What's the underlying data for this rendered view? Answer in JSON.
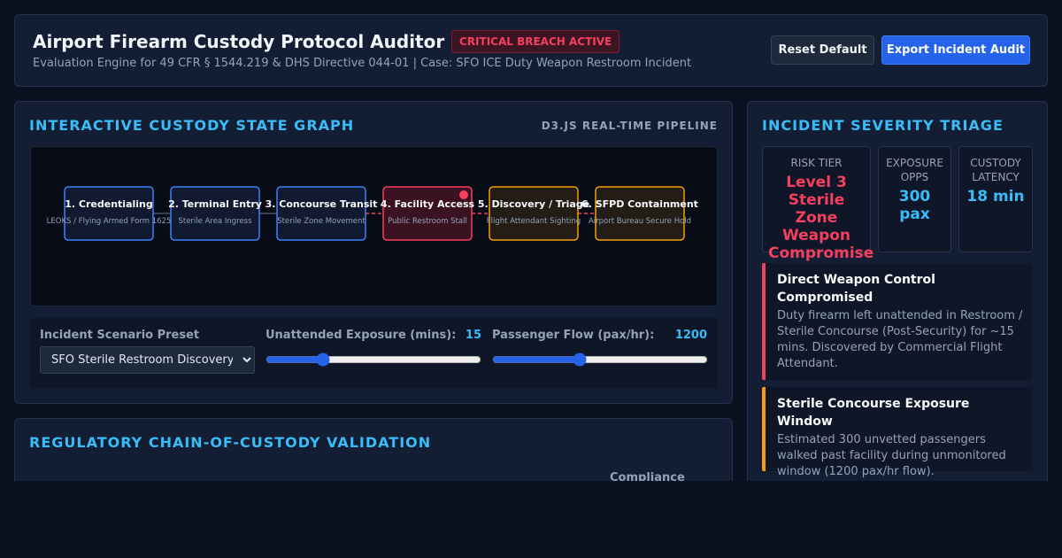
{
  "header": {
    "title": "Airport Firearm Custody Protocol Auditor",
    "badge": "CRITICAL BREACH ACTIVE",
    "subtitle": "Evaluation Engine for 49 CFR § 1544.219 & DHS Directive 044-01 | Case: SFO ICE Duty Weapon Restroom Incident",
    "reset_label": "Reset Default",
    "export_label": "Export Incident Audit"
  },
  "graph_panel": {
    "heading": "INTERACTIVE CUSTODY STATE GRAPH",
    "pipeline_tag": "D3.JS REAL-TIME PIPELINE",
    "nodes": [
      {
        "title": "1. Credentialing",
        "subtitle": "LEOKS / Flying Armed Form 1625",
        "state": "normal"
      },
      {
        "title": "2. Terminal Entry",
        "subtitle": "Sterile Area Ingress",
        "state": "normal"
      },
      {
        "title": "3. Concourse Transit",
        "subtitle": "Sterile Zone Movement",
        "state": "normal"
      },
      {
        "title": "4. Facility Access",
        "subtitle": "Public Restroom Stall",
        "state": "breach"
      },
      {
        "title": "5. Discovery / Triage",
        "subtitle": "Flight Attendant Sighting",
        "state": "warning"
      },
      {
        "title": "6. SFPD Containment",
        "subtitle": "Airport Bureau Secure Hold",
        "state": "warning"
      }
    ],
    "colors": {
      "normal": "#3b82f6",
      "breach": "#f43f5e",
      "warning": "#f59e0b"
    }
  },
  "controls": {
    "preset_label": "Incident Scenario Preset",
    "preset_value": "SFO Sterile Restroom Discovery (N",
    "exposure_label": "Unattended Exposure (mins):",
    "exposure_value": 15,
    "exposure_max": 60,
    "flow_label": "Passenger Flow (pax/hr):",
    "flow_value": 1200,
    "flow_max": 3000
  },
  "triage": {
    "heading": "INCIDENT SEVERITY TRIAGE",
    "metrics": [
      {
        "label": "RISK TIER",
        "value": "Level 3 Sterile Zone Weapon Compromise",
        "color": "#f43f5e"
      },
      {
        "label": "EXPOSURE OPPS",
        "value": "300 pax",
        "color": "#38bdf8"
      },
      {
        "label": "CUSTODY LATENCY",
        "value": "18 min",
        "color": "#38bdf8"
      }
    ],
    "alerts": [
      {
        "title": "Direct Weapon Control Compromised",
        "text": "Duty firearm left unattended in Restroom / Sterile Concourse (Post-Security) for ~15 mins. Discovered by Commercial Flight Attendant."
      },
      {
        "title": "Sterile Concourse Exposure Window",
        "text": "Estimated 300 unvetted passengers walked past facility during unmonitored window (1200 pax/hr flow)."
      }
    ]
  },
  "validation": {
    "heading": "REGULATORY CHAIN-OF-CUSTODY VALIDATION",
    "compliance_col": "Compliance"
  }
}
